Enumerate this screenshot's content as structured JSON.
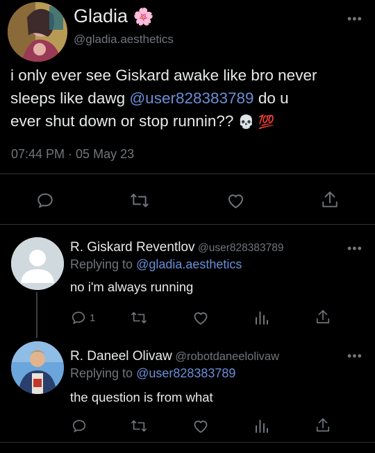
{
  "main_tweet": {
    "display_name": "Gladia",
    "display_name_emoji": "🌸",
    "handle": "@gladia.aesthetics",
    "text_line1": "i only ever see Giskard awake like bro never",
    "text_line2_pre": "sleeps like dawg ",
    "mention": "@user828383789",
    "text_line2_post": " do u",
    "text_line3": "ever shut down or stop runnin?? ",
    "text_emojis": "💀 💯",
    "time": "07:44 PM",
    "date_sep": " · ",
    "date": "05 May 23",
    "more_label": "•••"
  },
  "replies": [
    {
      "display_name": "R. Giskard Reventlov",
      "handle": "@user828383789",
      "replying_prefix": "Replying to ",
      "replying_to": "@gladia.aesthetics",
      "text": "no i'm always running",
      "reply_count": "1",
      "more_label": "•••"
    },
    {
      "display_name": "R. Daneel Olivaw",
      "handle": "@robotdaneelolivaw",
      "replying_prefix": "Replying to ",
      "replying_to": "@user828383789",
      "text": "the question is from what",
      "reply_count": "",
      "more_label": "•••"
    }
  ],
  "colors": {
    "background": "#000000",
    "text": "#e7e9ea",
    "muted": "#71767b",
    "link": "#6a8fd8",
    "divider": "#2f3336"
  },
  "icons": [
    "comment-icon",
    "retweet-icon",
    "like-icon",
    "analytics-icon",
    "share-icon"
  ]
}
